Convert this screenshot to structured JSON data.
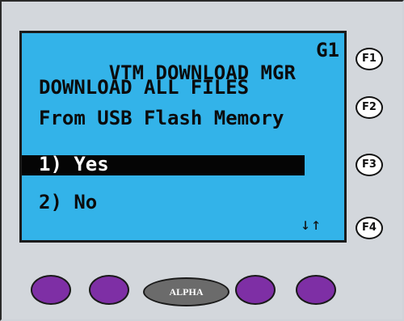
{
  "screen": {
    "title": "VTM DOWNLOAD MGR",
    "indicator": "G1",
    "line2": "DOWNLOAD ALL FILES",
    "line3": "From USB Flash Memory",
    "options": [
      {
        "label": "1) Yes",
        "selected": true
      },
      {
        "label": "2) No",
        "selected": false
      }
    ],
    "scroll_arrows": "↓↑"
  },
  "function_keys": [
    "F1",
    "F2",
    "F3",
    "F4"
  ],
  "soft_keys": {
    "alpha_label": "ALPHA"
  },
  "colors": {
    "lcd_background": "#33b3e9",
    "selection_bar": "#050505",
    "soft_key": "#7e2fa5",
    "alpha_key": "#6b6b6b"
  }
}
